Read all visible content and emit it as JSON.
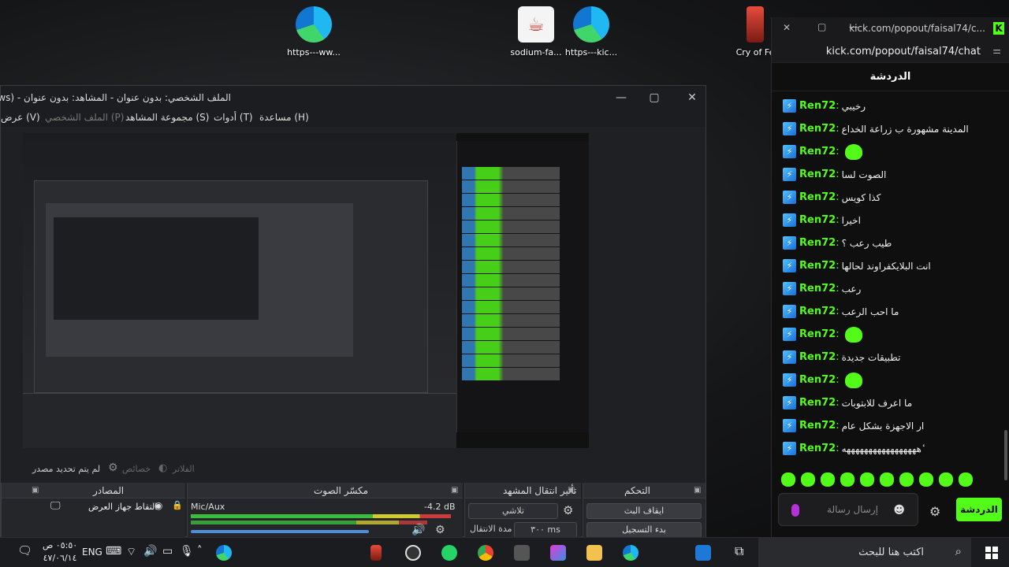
{
  "desktop": {
    "icons": [
      {
        "label": "https---ww...",
        "icon": "edge-icon"
      },
      {
        "label": "sodium-fa...",
        "icon": "java-icon"
      },
      {
        "label": "https---kic...",
        "icon": "edge-icon"
      },
      {
        "label": "Cry of Fe",
        "icon": "phone-game-icon"
      }
    ]
  },
  "obs": {
    "title": "الملف الشخصي: بدون عنوان - المشاهد: بدون عنوان - (windows",
    "menu": {
      "help": "مساعدة (H)",
      "tools": "أدوات (T)",
      "scene_collection": "مجموعة المشاهد (S)",
      "profile": "الملف الشخصي (P)",
      "view": "عرض (V)"
    },
    "source_bar": {
      "no_source": "لم يتم تحديد مصدر",
      "properties": "خصائص",
      "filters": "الفلاتر"
    },
    "docks": {
      "sources": {
        "title": "المصادر",
        "item": "التقاط جهاز العرض"
      },
      "mixer": {
        "title": "مكسّر الصوت",
        "channel": "Mic/Aux",
        "level": "-4.2 dB"
      },
      "transitions": {
        "title": "تأثير انتقال المشهد",
        "type": "تلاشي",
        "duration_label": "مدة الانتقال",
        "duration": "٣٠٠ ms"
      },
      "controls": {
        "title": "التحكم",
        "stop_stream": "ايقاف البث",
        "start_record": "بدء التسجيل"
      }
    }
  },
  "chat": {
    "window_title": "kick.com/popout/faisal74/c...",
    "address": "kick.com/popout/faisal74/chat",
    "header": "الدردشة",
    "messages": [
      {
        "user": "Ren72",
        "text": "رخيبي"
      },
      {
        "user": "Ren72",
        "text": "المدينة مشهورة ب زراعة الخداع"
      },
      {
        "user": "Ren72",
        "text": "",
        "emote": true
      },
      {
        "user": "Ren72",
        "text": "الصوت لسا"
      },
      {
        "user": "Ren72",
        "text": "كذا كويس"
      },
      {
        "user": "Ren72",
        "text": "اخيرا"
      },
      {
        "user": "Ren72",
        "text": "طيب رعب ؟"
      },
      {
        "user": "Ren72",
        "text": "انت البلايكفراوند لحالها"
      },
      {
        "user": "Ren72",
        "text": "رعب"
      },
      {
        "user": "Ren72",
        "text": "ما احب الرعب"
      },
      {
        "user": "Ren72",
        "text": "",
        "emote": true
      },
      {
        "user": "Ren72",
        "text": "تطبيقات جديدة"
      },
      {
        "user": "Ren72",
        "text": "",
        "emote": true
      },
      {
        "user": "Ren72",
        "text": "ما اعرف للابتوبات"
      },
      {
        "user": "Ren72",
        "text": "ار الاجهزة بشكل عام"
      },
      {
        "user": "Ren72",
        "text": "ٔهههههههههههههههههه"
      }
    ],
    "input_placeholder": "إرسال رسالة",
    "send_label": "الدردشة",
    "accent": "#53fc18"
  },
  "taskbar": {
    "search_placeholder": "اكتب هنا للبحث",
    "time": "٠٥:٥٠ ص",
    "date": "٤٧/٠٦/١٤",
    "lang": "ENG"
  }
}
